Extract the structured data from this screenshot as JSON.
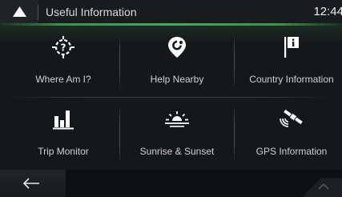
{
  "header": {
    "title": "Useful Information",
    "clock": "12:44"
  },
  "icons": {
    "back_up": "triangle-up-icon",
    "back": "arrow-left-icon",
    "more": "chevron-up-icon"
  },
  "colors": {
    "accent": "#38b257",
    "background": "#16171b",
    "text": "#cfd0d3"
  },
  "items": [
    {
      "label": "Where Am I?",
      "icon": "location-question-icon"
    },
    {
      "label": "Help Nearby",
      "icon": "help-pin-icon"
    },
    {
      "label": "Country Information",
      "icon": "info-flag-icon"
    },
    {
      "label": "Trip Monitor",
      "icon": "bar-chart-icon"
    },
    {
      "label": "Sunrise & Sunset",
      "icon": "sunrise-icon"
    },
    {
      "label": "GPS Information",
      "icon": "satellite-icon"
    }
  ]
}
